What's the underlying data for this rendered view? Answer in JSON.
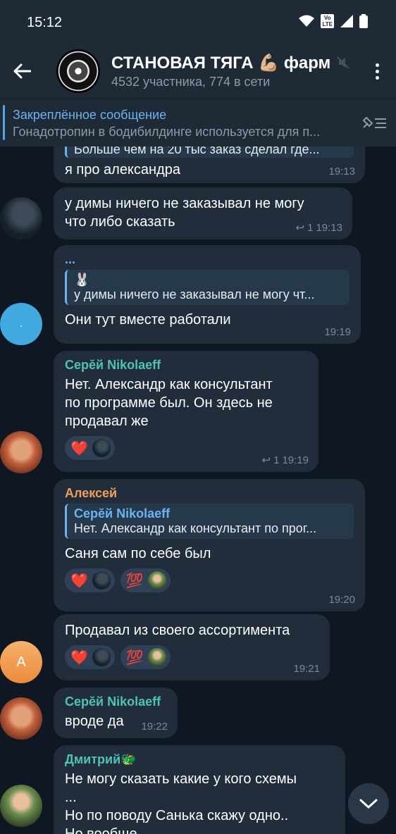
{
  "status_bar": {
    "time": "15:12",
    "volte_top": "Vo",
    "volte_bottom": "LTE"
  },
  "header": {
    "title": "СТАНОВАЯ ТЯГА",
    "title_emoji": "💪🏼",
    "title_suffix": "фарм",
    "subtitle": "4532 участника, 774 в сети"
  },
  "pinned": {
    "title": "Закреплённое сообщение",
    "text": "Гонадотропин в бодибилдинге используется для п..."
  },
  "messages": [
    {
      "partial_quote": "Больше чем на 20 тыс заказ сделал где...",
      "text": "я про александра",
      "time": "19:13"
    },
    {
      "text_line1": "у димы ничего не заказывал не могу",
      "text_line2": "что либо сказать",
      "reply_count": "1",
      "time": "19:13"
    },
    {
      "sender": "...",
      "quote_name": "🐰",
      "quote_text": "у димы ничего не заказывал не могу чт...",
      "text": "Они тут вместе работали",
      "time": "19:19",
      "avatar_text": "."
    },
    {
      "sender": "Серĕй Nikolaeff",
      "text_line1": "Нет. Александр как консультант",
      "text_line2": "по программе был. Он здесь не",
      "text_line3": "продавал же",
      "reaction1": "❤️",
      "reply_count": "1",
      "time": "19:19"
    },
    {
      "sender": "Алексей",
      "quote_name": "Серĕй Nikolaeff",
      "quote_text": "Нет. Александр как консультант по прог...",
      "text": "Саня сам по себе был",
      "reaction1": "❤️",
      "reaction2": "💯",
      "time": "19:20"
    },
    {
      "text": "Продавал из своего ассортимента",
      "reaction1": "❤️",
      "reaction2": "💯",
      "time": "19:21",
      "avatar_text": "А"
    },
    {
      "sender": "Серĕй Nikolaeff",
      "text": "вроде да",
      "time": "19:22"
    },
    {
      "sender": "Дмитрий",
      "sender_emoji": "🐲",
      "text_line1": "Не могу сказать какие у кого схемы",
      "text_line2": "...",
      "text_line3": "Но по поводу Санька скажу одно..",
      "text_line4": "Но вообще ..."
    }
  ],
  "colors": {
    "accent": "#6ab3f3",
    "teal": "#4fc3b3",
    "orange": "#f0a05a",
    "bubble": "#212d3b"
  }
}
